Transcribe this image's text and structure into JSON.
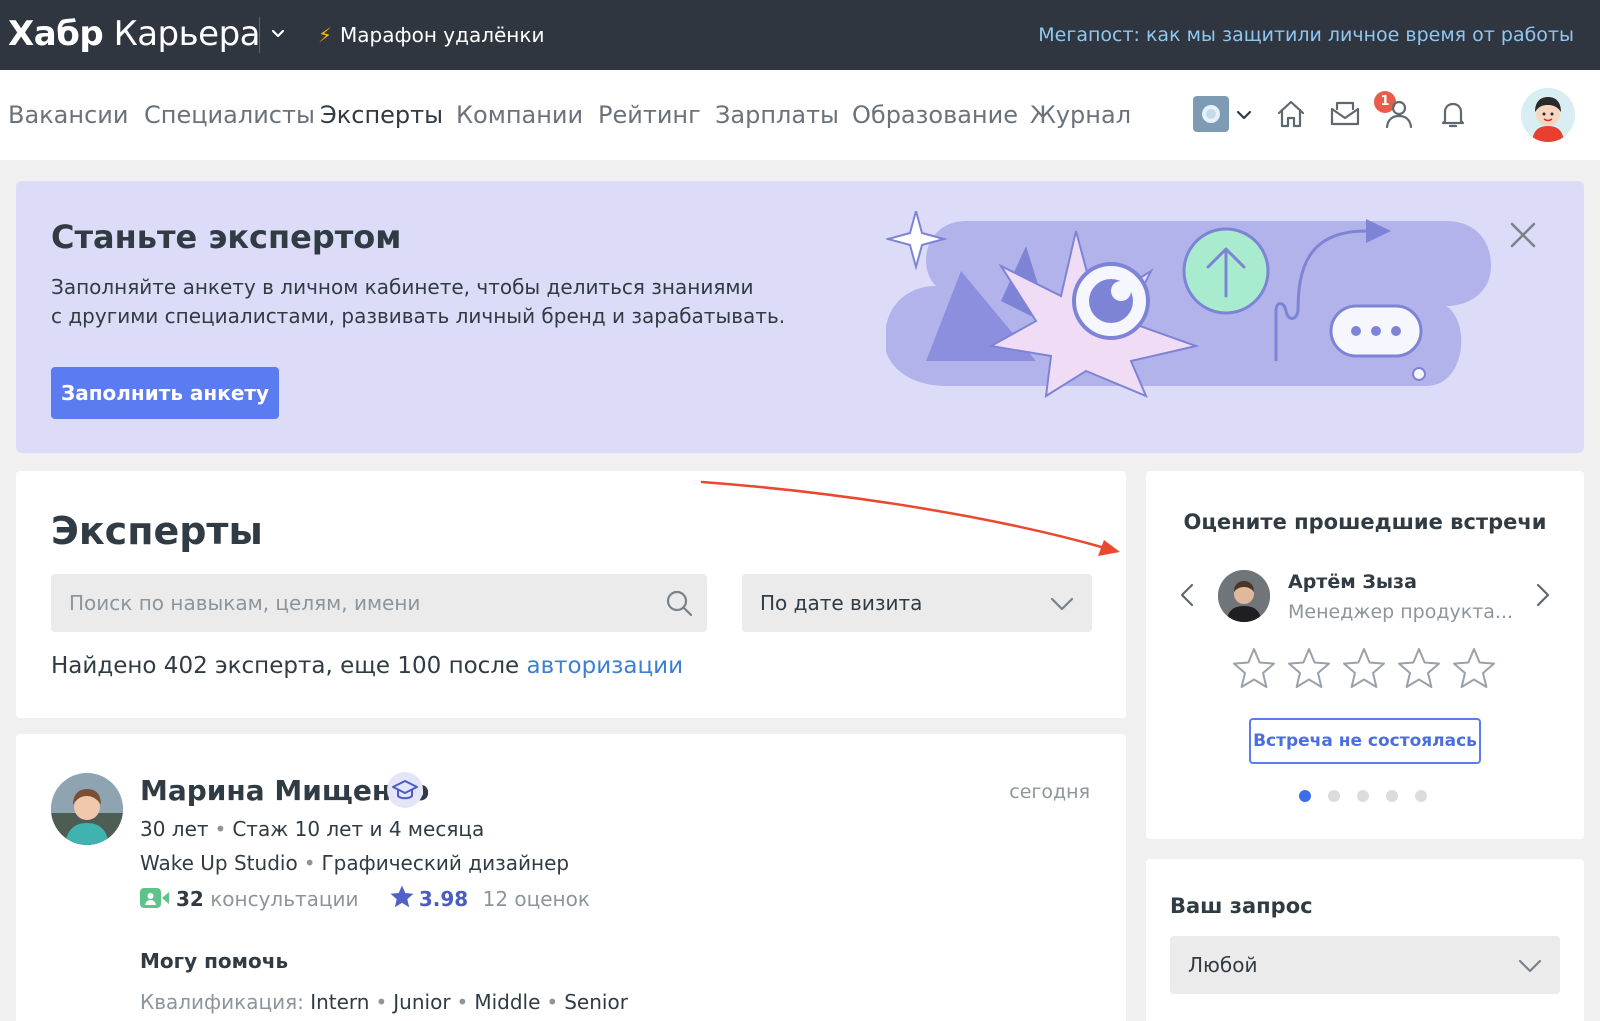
{
  "topbar": {
    "logo_bold": "Хабр",
    "logo_rest": "Карьера",
    "marathon_label": "Марафон удалёнки",
    "megapost_label": "Мегапост: как мы защитили личное время от работы"
  },
  "nav": {
    "items": [
      {
        "label": "Вакансии",
        "active": false
      },
      {
        "label": "Специалисты",
        "active": false
      },
      {
        "label": "Эксперты",
        "active": true
      },
      {
        "label": "Компании",
        "active": false
      },
      {
        "label": "Рейтинг",
        "active": false
      },
      {
        "label": "Зарплаты",
        "active": false
      },
      {
        "label": "Образование",
        "active": false
      },
      {
        "label": "Журнал",
        "active": false
      }
    ],
    "messages_badge": "1"
  },
  "banner": {
    "title": "Станьте экспертом",
    "text_line1": "Заполняйте анкету в личном кабинете, чтобы делиться знаниями",
    "text_line2": "с другими специалистами, развивать личный бренд и зарабатывать.",
    "button_label": "Заполнить анкету"
  },
  "experts": {
    "title": "Эксперты",
    "search_placeholder": "Поиск по навыкам, целям, имени",
    "sort_label": "По дате визита",
    "found_text": "Найдено 402 эксперта, еще 100 после ",
    "found_link": "авторизации"
  },
  "expert_item": {
    "name": "Марина Мищенко",
    "date": "сегодня",
    "age": "30 лет",
    "experience": "Стаж 10 лет и 4 месяца",
    "company": "Wake Up Studio",
    "position": "Графический дизайнер",
    "consultations_count": "32",
    "consultations_label": "консультации",
    "rating": "3.98",
    "ratings_count": "12 оценок",
    "can_help_title": "Могу помочь",
    "qualification_label": "Квалификация:",
    "qualifications": [
      "Intern",
      "Junior",
      "Middle",
      "Senior"
    ]
  },
  "rate_meetings": {
    "title": "Оцените прошедшие встречи",
    "person_name": "Артём Зыза",
    "person_role": "Менеджер продукта...",
    "stars_total": 5,
    "stars_selected": 0,
    "no_meeting_button": "Встреча не состоялась",
    "pages_total": 5,
    "page_active": 1
  },
  "request": {
    "title": "Ваш запрос",
    "selected": "Любой"
  },
  "colors": {
    "accent": "#5b7bf0",
    "topbar_bg": "#2f3640",
    "banner_bg": "#dcdcf8",
    "annotation_arrow": "#e84a2f"
  }
}
